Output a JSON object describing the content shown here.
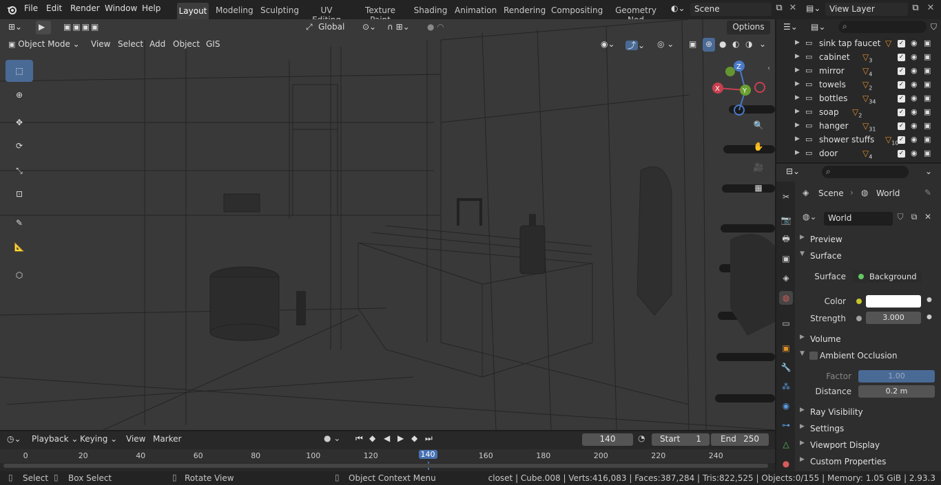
{
  "topbar": {
    "menus": [
      "File",
      "Edit",
      "Render",
      "Window",
      "Help"
    ],
    "workspaces": [
      "Layout",
      "Modeling",
      "Sculpting",
      "UV Editing",
      "Texture Paint",
      "Shading",
      "Animation",
      "Rendering",
      "Compositing",
      "Geometry Nod"
    ],
    "active_workspace": "Layout",
    "scene": "Scene",
    "view_layer": "View Layer"
  },
  "viewport_header": {
    "orientation": "Global",
    "options": "Options",
    "mode": "Object Mode",
    "menus": [
      "View",
      "Select",
      "Add",
      "Object",
      "GIS"
    ]
  },
  "gizmo": {
    "z": "Z",
    "x": "X",
    "y": "Y"
  },
  "outliner": {
    "rows": [
      {
        "name": "sink tap faucet",
        "badge": ""
      },
      {
        "name": "cabinet",
        "badge": "3"
      },
      {
        "name": "mirror",
        "badge": "4"
      },
      {
        "name": "towels",
        "badge": "2"
      },
      {
        "name": "bottles",
        "badge": "34"
      },
      {
        "name": "soap",
        "badge": "2"
      },
      {
        "name": "hanger",
        "badge": "31"
      },
      {
        "name": "shower stuffs",
        "badge": "10"
      },
      {
        "name": "door",
        "badge": "4"
      }
    ]
  },
  "properties": {
    "breadcrumb_scene": "Scene",
    "breadcrumb_world": "World",
    "world_name": "World",
    "panels": {
      "preview": "Preview",
      "surface": "Surface",
      "volume": "Volume",
      "ao": "Ambient Occlusion",
      "ray": "Ray Visibility",
      "settings": "Settings",
      "viewport_display": "Viewport Display",
      "custom_props": "Custom Properties"
    },
    "surface_label": "Surface",
    "surface_value": "Background",
    "color_label": "Color",
    "color_value": "#ffffff",
    "strength_label": "Strength",
    "strength_value": "3.000",
    "factor_label": "Factor",
    "factor_value": "1.00",
    "distance_label": "Distance",
    "distance_value": "0.2 m"
  },
  "timeline": {
    "menus": [
      "Playback",
      "Keying",
      "View",
      "Marker"
    ],
    "current_frame": "140",
    "start_label": "Start",
    "start": "1",
    "end_label": "End",
    "end": "250",
    "ticks": [
      "0",
      "20",
      "40",
      "60",
      "80",
      "100",
      "120",
      "140",
      "160",
      "180",
      "200",
      "220",
      "240"
    ]
  },
  "statusbar": {
    "select": "Select",
    "box_select": "Box Select",
    "rotate_view": "Rotate View",
    "context_menu": "Object Context Menu",
    "stats": "closet | Cube.008 | Verts:416,083 | Faces:387,284 | Tris:822,525 | Objects:0/155 | Memory: 1.05 GiB | 2.93.3"
  },
  "colors": {
    "accent": "#4a6a96",
    "frame_highlight": "#4772b3",
    "viewport_bg": "#393939",
    "panel_bg": "#2e2e2e"
  }
}
